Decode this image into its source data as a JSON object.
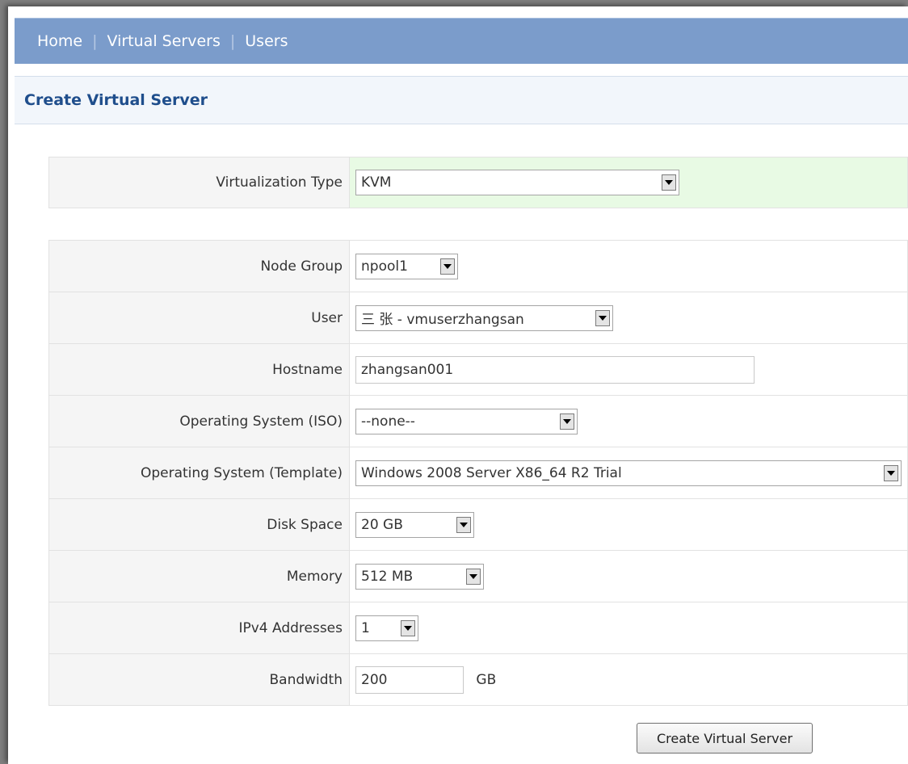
{
  "nav": {
    "home": "Home",
    "separator": "|",
    "virtual_servers": "Virtual Servers",
    "users": "Users"
  },
  "header": {
    "title": "Create Virtual Server"
  },
  "virtualization": {
    "label": "Virtualization Type",
    "value": "KVM"
  },
  "fields": {
    "node_group": {
      "label": "Node Group",
      "value": "npool1"
    },
    "user": {
      "label": "User",
      "value": "三 张 - vmuserzhangsan"
    },
    "hostname": {
      "label": "Hostname",
      "value": "zhangsan001"
    },
    "os_iso": {
      "label": "Operating System (ISO)",
      "value": "--none--"
    },
    "os_template": {
      "label": "Operating System (Template)",
      "value": "Windows 2008 Server X86_64 R2 Trial"
    },
    "disk_space": {
      "label": "Disk Space",
      "value": "20 GB"
    },
    "memory": {
      "label": "Memory",
      "value": "512 MB"
    },
    "ipv4": {
      "label": "IPv4 Addresses",
      "value": "1"
    },
    "bandwidth": {
      "label": "Bandwidth",
      "value": "200",
      "unit": "GB"
    }
  },
  "actions": {
    "submit": "Create Virtual Server"
  },
  "colors": {
    "navbar": "#7b9ccb",
    "title": "#1f4e8c",
    "highlight_field": "#e8fae4"
  },
  "icons": {
    "dropdown": "chevron-down-icon"
  }
}
